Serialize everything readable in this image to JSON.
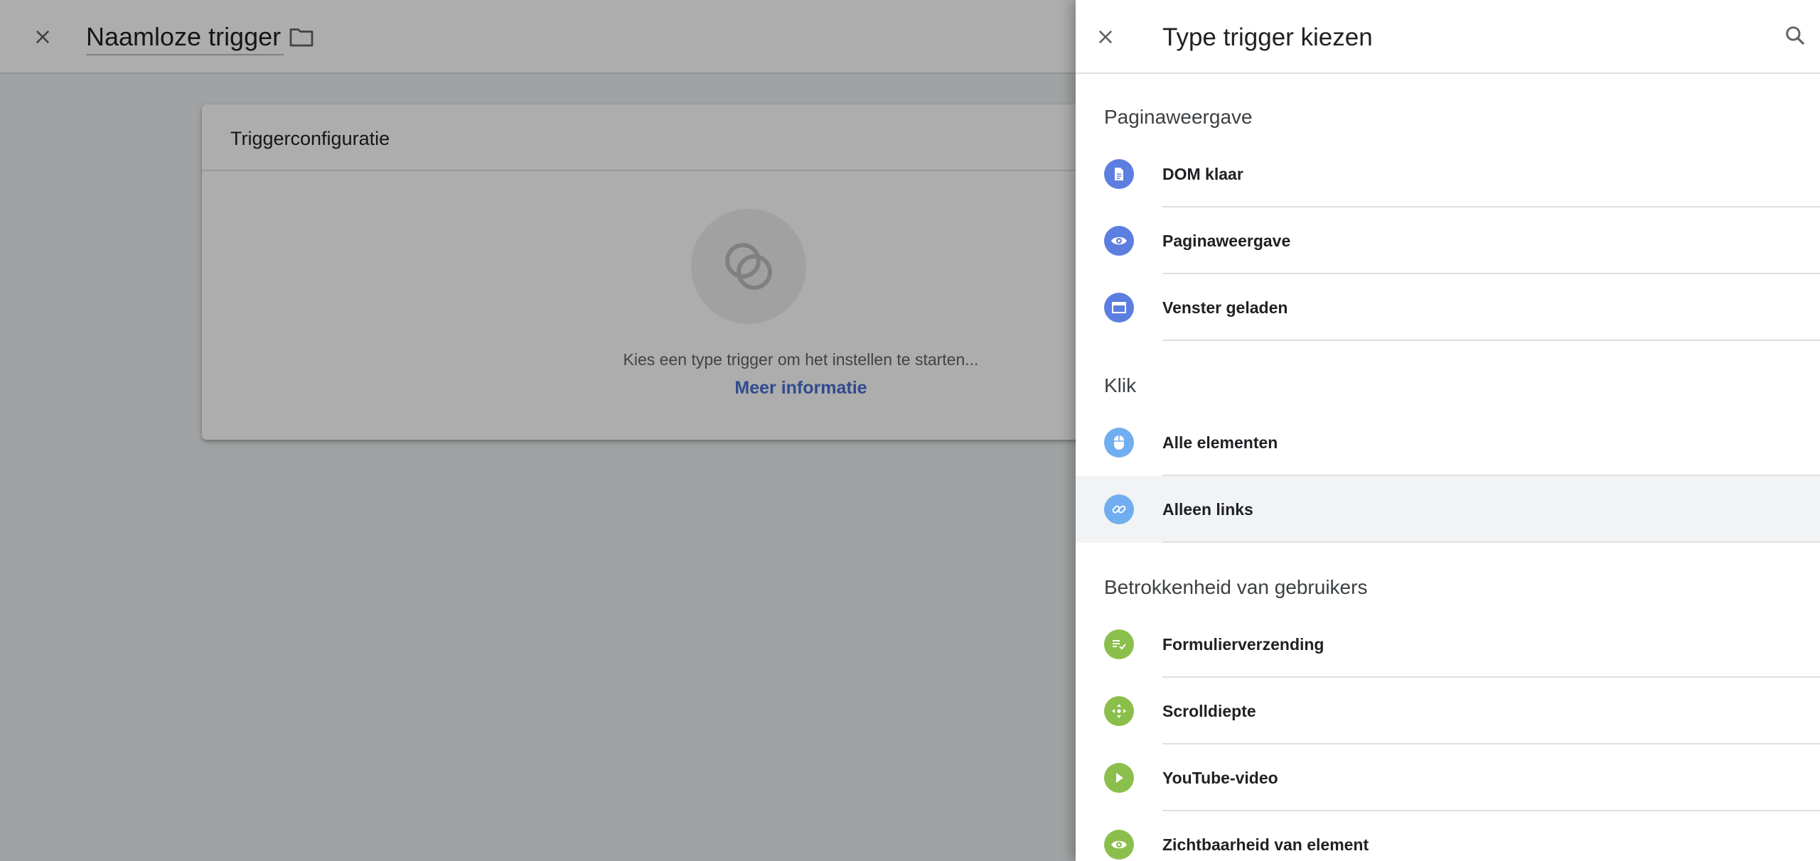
{
  "editor": {
    "title": "Naamloze trigger",
    "card_title": "Triggerconfiguratie",
    "hint": "Kies een type trigger om het instellen te starten...",
    "link": "Meer informatie"
  },
  "drawer": {
    "title": "Type trigger kiezen",
    "sections": [
      {
        "title": "Paginaweergave",
        "items": [
          {
            "label": "DOM klaar",
            "icon": "document-icon",
            "color": "#5c7ee0"
          },
          {
            "label": "Paginaweergave",
            "icon": "eye-icon",
            "color": "#5c7ee0"
          },
          {
            "label": "Venster geladen",
            "icon": "window-icon",
            "color": "#5c7ee0"
          }
        ]
      },
      {
        "title": "Klik",
        "items": [
          {
            "label": "Alle elementen",
            "icon": "mouse-icon",
            "color": "#70aef0"
          },
          {
            "label": "Alleen links",
            "icon": "link-icon",
            "color": "#70aef0",
            "selected": true
          }
        ]
      },
      {
        "title": "Betrokkenheid van gebruikers",
        "items": [
          {
            "label": "Formulierverzending",
            "icon": "form-check-icon",
            "color": "#8bbf4b"
          },
          {
            "label": "Scrolldiepte",
            "icon": "move-arrows-icon",
            "color": "#8bbf4b"
          },
          {
            "label": "YouTube-video",
            "icon": "play-icon",
            "color": "#8bbf4b"
          },
          {
            "label": "Zichtbaarheid van element",
            "icon": "eye-icon",
            "color": "#8bbf4b"
          }
        ]
      }
    ]
  }
}
